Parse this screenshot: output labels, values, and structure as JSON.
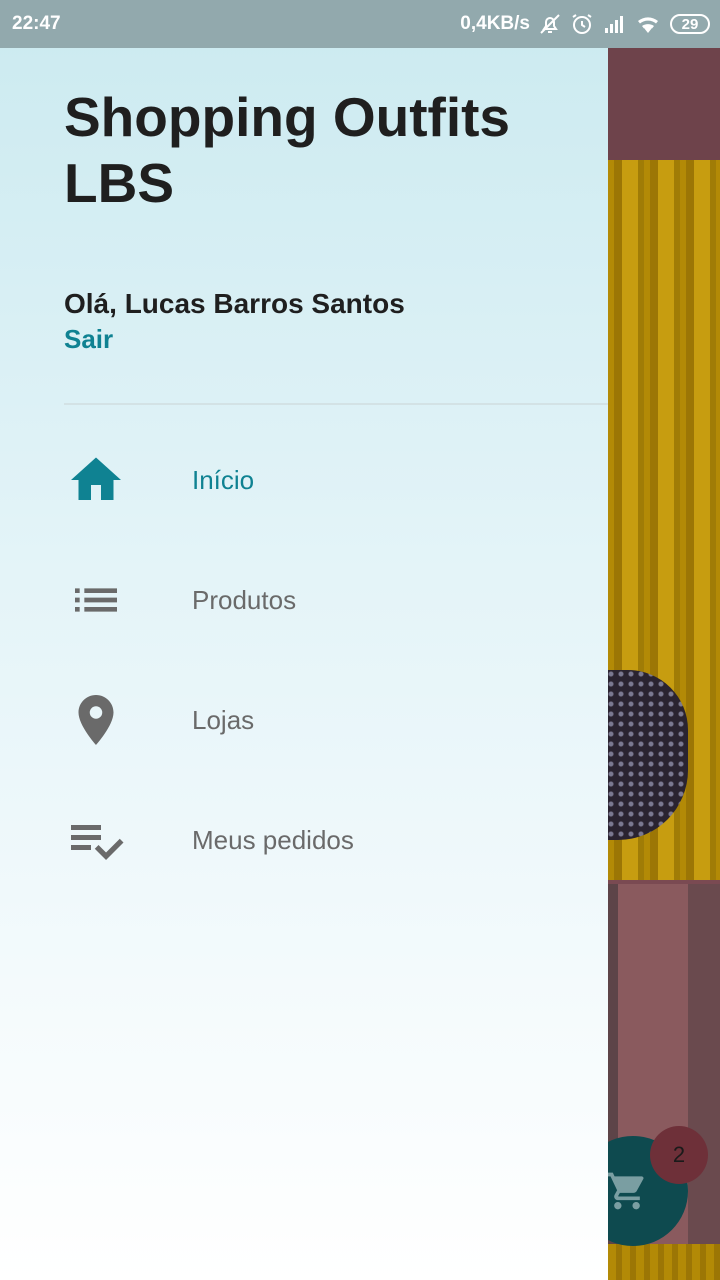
{
  "status_bar": {
    "time": "22:47",
    "network_speed": "0,4KB/s",
    "battery_level": "29",
    "icons": [
      "bell-off-icon",
      "alarm-icon",
      "signal-icon",
      "wifi-icon",
      "battery-icon"
    ]
  },
  "drawer": {
    "title": "Shopping Outfits LBS",
    "greeting": "Olá, Lucas Barros Santos",
    "logout_label": "Sair",
    "items": [
      {
        "label": "Início",
        "icon": "home-icon",
        "active": true
      },
      {
        "label": "Produtos",
        "icon": "list-icon",
        "active": false
      },
      {
        "label": "Lojas",
        "icon": "location-pin-icon",
        "active": false
      },
      {
        "label": "Meus pedidos",
        "icon": "playlist-check-icon",
        "active": false
      }
    ]
  },
  "cart": {
    "count": "2",
    "icon": "cart-icon"
  },
  "colors": {
    "accent": "#0f8292",
    "icon_gray": "#6a6a6a",
    "status_bar": "#92a9ad",
    "fab": "#0e4a4f",
    "badge": "#6e3039"
  }
}
